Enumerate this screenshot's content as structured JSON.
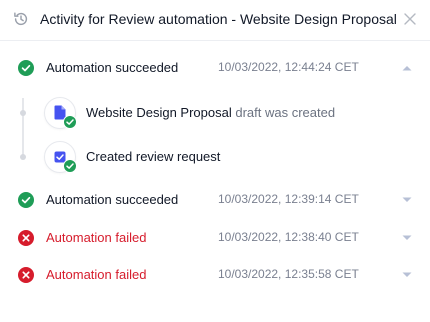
{
  "header": {
    "title": "Activity for Review automation - Website Design Proposal",
    "history_icon": "history-icon",
    "close_icon": "close-icon"
  },
  "colors": {
    "success": "#1f9d57",
    "failure": "#d61c2c",
    "primary": "#4653f0",
    "muted": "#7a8090"
  },
  "runs": [
    {
      "status": "success",
      "label": "Automation succeeded",
      "timestamp": "10/03/2022, 12:44:24 CET",
      "expanded": true,
      "chevron": "chevron-up-icon"
    },
    {
      "status": "success",
      "label": "Automation succeeded",
      "timestamp": "10/03/2022, 12:39:14 CET",
      "expanded": false,
      "chevron": "chevron-down-icon"
    },
    {
      "status": "failed",
      "label": "Automation failed",
      "timestamp": "10/03/2022, 12:38:40 CET",
      "expanded": false,
      "chevron": "chevron-down-icon"
    },
    {
      "status": "failed",
      "label": "Automation failed",
      "timestamp": "10/03/2022, 12:35:58 CET",
      "expanded": false,
      "chevron": "chevron-down-icon"
    }
  ],
  "events": [
    {
      "icon": "document-icon",
      "name": "Website Design Proposal",
      "suffix": "draft was created"
    },
    {
      "icon": "checkbox-icon",
      "name": "Created review request",
      "suffix": ""
    }
  ]
}
